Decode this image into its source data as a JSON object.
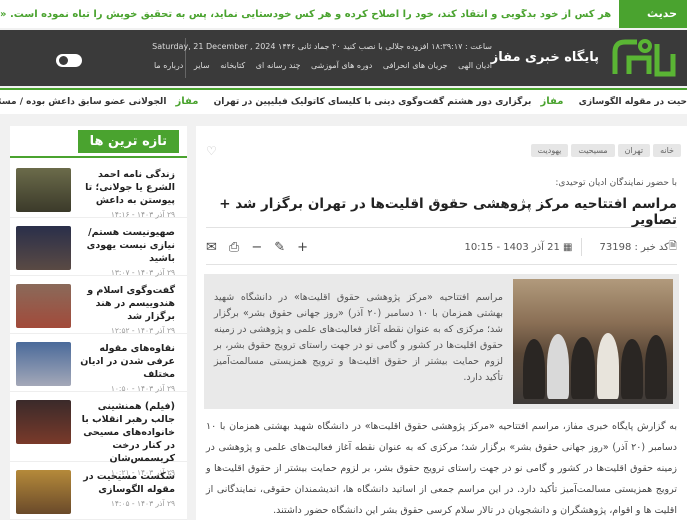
{
  "hadith": {
    "label": "حدیث روز",
    "text": "هر کس از خود بدگویی و انتقاد کند، خود را اصلاح کرده و هر کس خودستایی نماید، پس به تحقیق خویش را تباه نموده است. «امام علی (ع)»"
  },
  "header": {
    "site_name": "پایگاه خبری مفاز",
    "meta": "ساعت : ۱۸:۳۹:۱۷  افزوده جلالی با نصب کنید  ۲۰ جماد ثانی ۱۴۴۶  Saturday, 21 December , 2024",
    "nav": [
      "ادیان الهی",
      "جریان های انحرافی",
      "دوره های آموزشی",
      "چند رسانه ای",
      "کتابخانه",
      "سایر",
      "درباره ما"
    ]
  },
  "ticker": {
    "items": [
      "حیت در مقوله الگوسازی",
      "برگزاری دور هشتم گفت‌وگوی دینی با کلیسای کاتولیک فیلیپین در تهران",
      "الجولانی عضو سابق داعش بوده / مسئولان جدید در سوریه قابل اعتماد نیستند"
    ],
    "logo": "مفاز"
  },
  "latest": {
    "title": "تازه ترین ها",
    "items": [
      {
        "text": "زندگی نامه احمد الشرع یا جولانی؛ تا پیوستن به داعش",
        "date": "۲۹ آذر ۱۴۰۳ - ۱۴:۱۶"
      },
      {
        "text": "صهیونیست هستم/ نیازی نیست یهودی باشید",
        "date": "۲۹ آذر ۱۴۰۳ - ۱۳:۰۷"
      },
      {
        "text": "گفت‌وگوی اسلام و هندوییسم در هند برگزار شد",
        "date": "۲۹ آذر ۱۴۰۳ - ۱۲:۵۲"
      },
      {
        "text": "نقاوه‌های مقوله عرفی شدن در ادیان مختلف",
        "date": "۲۹ آذر ۱۴۰۳ - ۱۰:۵۰"
      },
      {
        "text": "(فیلم) همنشینی جالب رهبر انقلاب با خانواده‌های مسیحی در کنار درخت کریسمس‌شان",
        "date": "۲۹ آذر ۱۴۰۳ - ۱۰:۲۱"
      },
      {
        "text": "شکست مسیحیت در مقوله الگوسازی",
        "date": "۲۹ آذر ۱۴۰۳ - ۱۴:۰۵"
      }
    ]
  },
  "article": {
    "tags": [
      "خانه",
      "تهران",
      "مسیحیت",
      "یهودیت"
    ],
    "lead": "با حضور نمایندگان ادیان توحیدی:",
    "headline": "مراسم افتتاحیه مرکز پژوهشی حقوق اقلیت‌ها در تهران برگزار شد + تصاویر",
    "news_code": "کد خبر : 73198",
    "datetime": "21 آذر 1403 - 10:15",
    "summary": "مراسم افتتاحیه «مرکز پژوهشی حقوق اقلیت‌ها» در دانشگاه شهید بهشتی همزمان با ۱۰ دسامبر (۲۰ آذر) «روز جهانی حقوق بشر» برگزار شد؛ مرکزی که به عنوان نقطه آغاز فعالیت‌های علمی و پژوهشی در زمینه حقوق اقلیت‌ها در کشور و گامی نو در جهت راستای ترویج حقوق بشر، بر لزوم حمایت بیشتر از حقوق اقلیت‌ها و ترویج همزیستی مسالمت‌آمیز تأکید دارد.",
    "body": "به گزارش پایگاه خبری مفاز، مراسم افتتاحیه «مرکز پژوهشی حقوق اقلیت‌ها» در دانشگاه شهید بهشتی همزمان با ۱۰ دسامبر (۲۰ آذر) «روز جهانی حقوق بشر» برگزار شد؛ مرکزی که به عنوان نقطه آغاز فعالیت‌های علمی و پژوهشی در زمینه حقوق اقلیت‌ها در کشور و گامی نو در جهت راستای ترویج حقوق بشر، بر لزوم حمایت بیشتر از حقوق اقلیت‌ها و ترویج همزیستی مسالمت‌آمیز تأکید دارد. در این مراسم جمعی از اساتید دانشگاه ها، اندیشمندان حقوقی، نمایندگانی از اقلیت ها و اقوام، پژوهشگران و دانشجویان در تالار سلام کرسی حقوق بشر این دانشگاه حضور داشتند."
  },
  "colors": {
    "accent": "#4aa32f",
    "header_bg": "#3a3a3a"
  }
}
